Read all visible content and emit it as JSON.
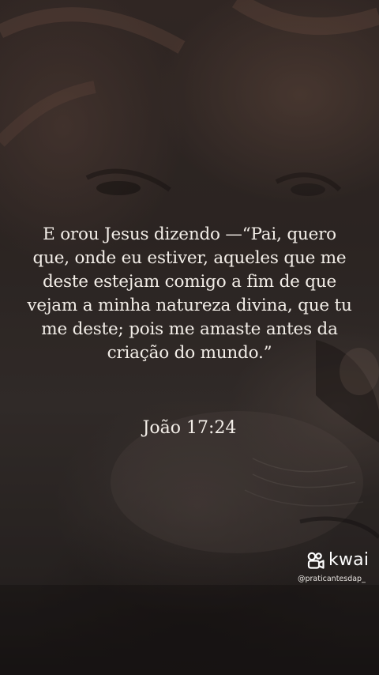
{
  "quote": {
    "text": "E orou Jesus dizendo —“Pai, quero que, onde eu estiver, aqueles que me deste estejam comigo a fim de que vejam a minha natureza divina, que tu me deste; pois me amaste antes da criação do mundo.”",
    "reference": "João 17:24"
  },
  "watermark": {
    "brand": "kwai",
    "handle": "@praticantesdap_",
    "icon": "kwai-logo-icon"
  },
  "colors": {
    "text": "#f3eee8",
    "background": "#332b28"
  }
}
